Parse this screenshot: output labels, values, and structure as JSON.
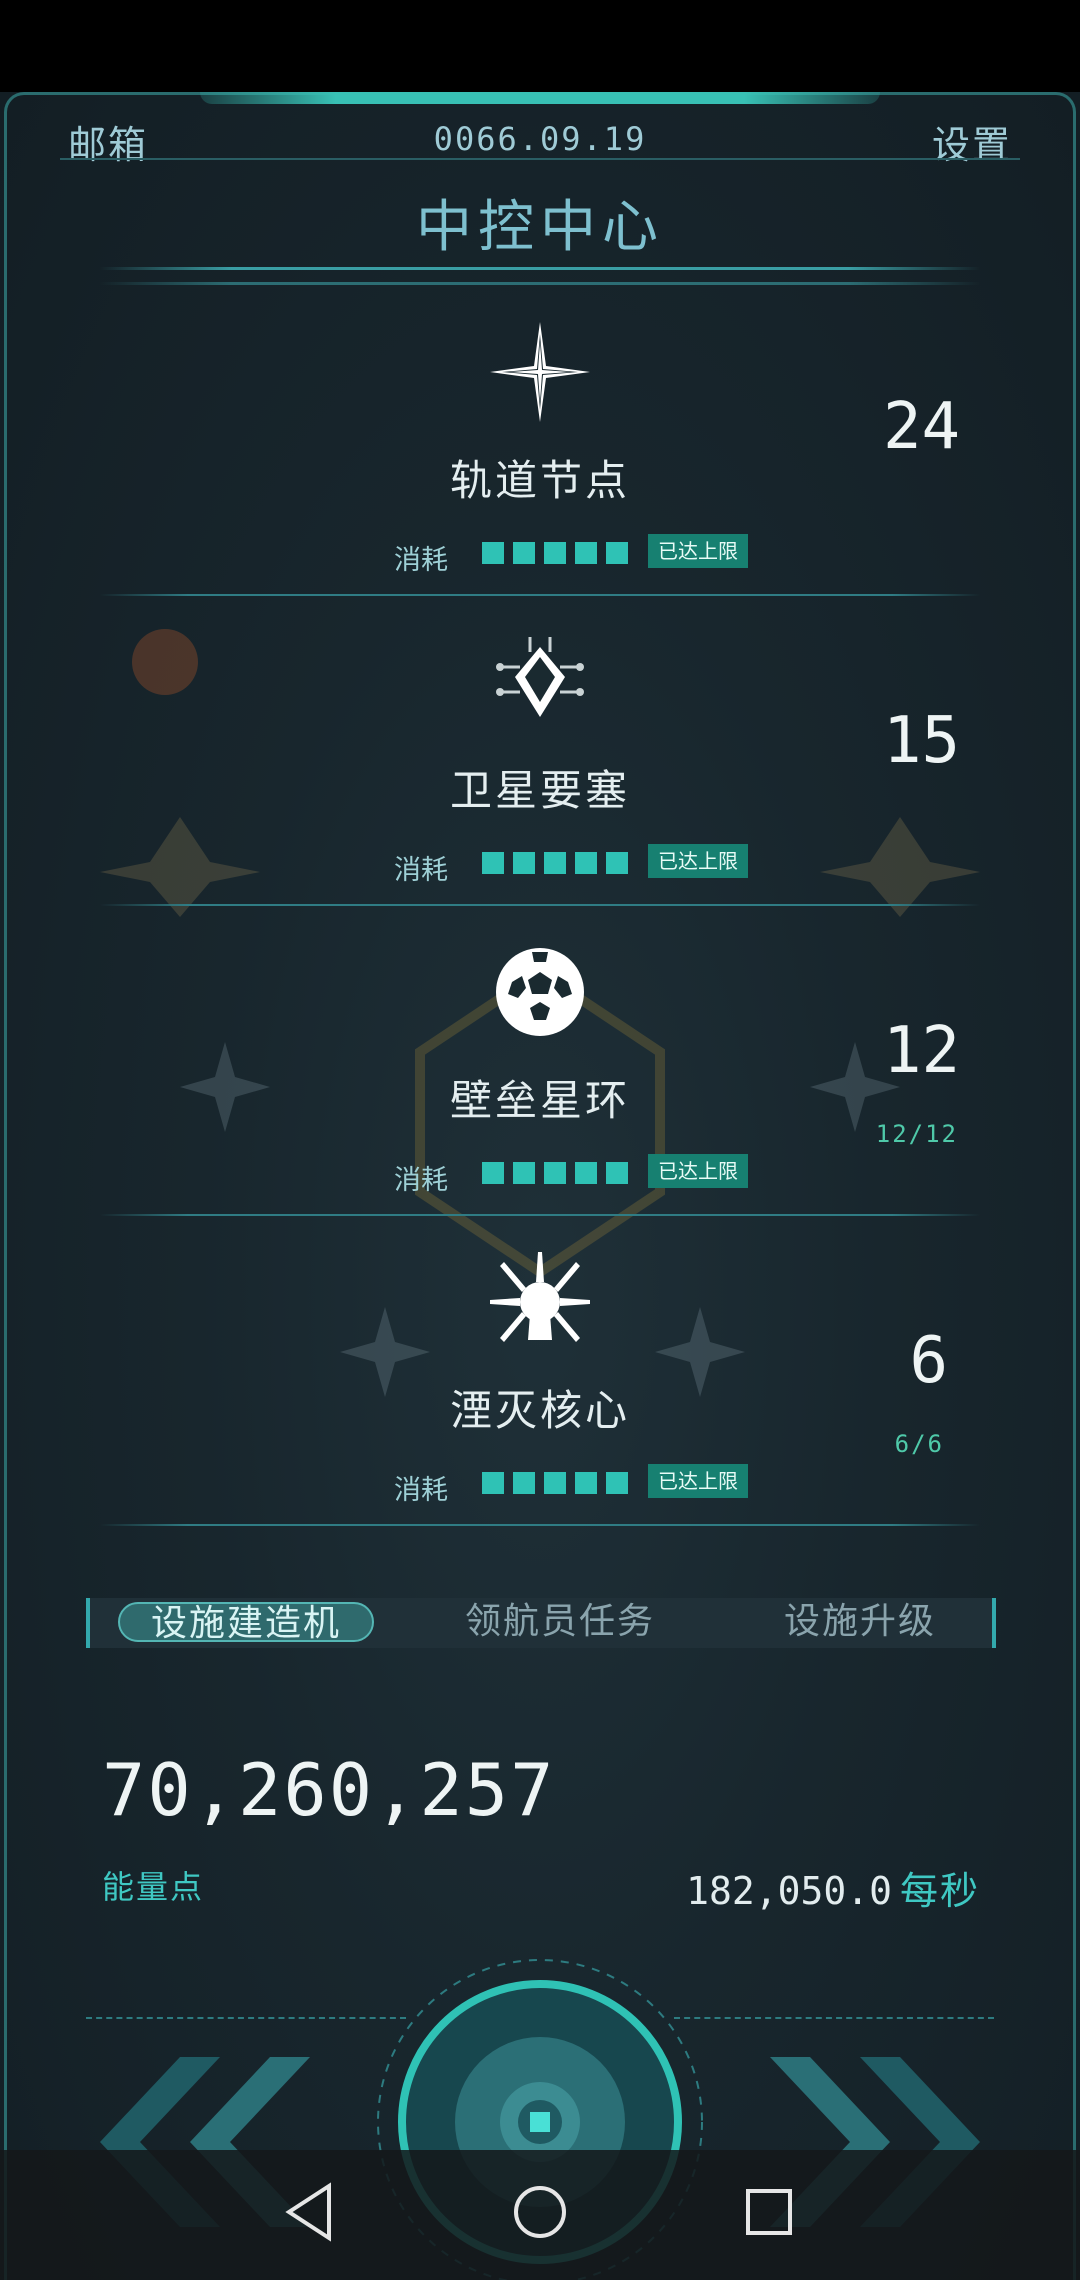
{
  "header": {
    "mailbox_label": "邮箱",
    "date": "0066.09.19",
    "settings_label": "设置",
    "title": "中控中心"
  },
  "facilities": [
    {
      "name": "轨道节点",
      "icon": "sparkle-star-icon",
      "cost_label": "消耗",
      "pips": 5,
      "badge": "已达上限",
      "count": "24",
      "sub": ""
    },
    {
      "name": "卫星要塞",
      "icon": "satellite-fortress-icon",
      "cost_label": "消耗",
      "pips": 5,
      "badge": "已达上限",
      "count": "15",
      "sub": ""
    },
    {
      "name": "壁垒星环",
      "icon": "geodesic-sphere-icon",
      "cost_label": "消耗",
      "pips": 5,
      "badge": "已达上限",
      "count": "12",
      "sub": "12/12"
    },
    {
      "name": "湮灭核心",
      "icon": "burst-core-icon",
      "cost_label": "消耗",
      "pips": 5,
      "badge": "已达上限",
      "count": "6",
      "sub": "6/6"
    }
  ],
  "tabs": [
    {
      "label": "设施建造机",
      "active": true
    },
    {
      "label": "领航员任务",
      "active": false
    },
    {
      "label": "设施升级",
      "active": false
    }
  ],
  "energy": {
    "value": "70,260,257",
    "label": "能量点",
    "rate": "182,050.0",
    "rate_unit": "每秒"
  },
  "controls": {
    "prev_icon": "double-chevron-left-icon",
    "next_icon": "double-chevron-right-icon",
    "center_icon": "core-button-icon"
  },
  "navbar": {
    "back_icon": "triangle-back-icon",
    "home_icon": "circle-home-icon",
    "recents_icon": "square-recents-icon"
  },
  "colors": {
    "accent": "#2fc2b5",
    "badge": "#178071",
    "title": "#7ec0cf",
    "background": "#18262d"
  }
}
